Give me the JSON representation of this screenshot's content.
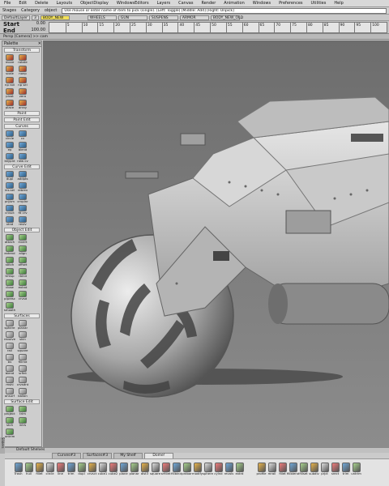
{
  "menubar": [
    "File",
    "Edit",
    "Delete",
    "Layouts",
    "ObjectDisplay",
    "WindowsEditors",
    "Layers",
    "Canvas",
    "Render",
    "Animation",
    "Windows",
    "Preferences",
    "Utilities",
    "Help"
  ],
  "toolrow": {
    "stages": "Stages",
    "category": "Category",
    "object": "object",
    "command_line": "Use mouse or enter name of item to pick (single). [Left: Toggle] [Middle: Add] [Right: Unpick]"
  },
  "layerrow": {
    "default": "DefaultLayer",
    "chips": [
      "BODY_NEW",
      "WHEELS",
      "GUN",
      "SUSPENS",
      "ARMOR",
      "BODY_NEW_OLD"
    ],
    "grid_num": "3"
  },
  "timeline": {
    "start_label": "Start",
    "start_value": "0.00",
    "end_label": "End",
    "end_value": "100.00",
    "current": "1.00",
    "ticks": [
      "5",
      "10",
      "15",
      "20",
      "25",
      "30",
      "35",
      "40",
      "45",
      "50",
      "55",
      "60",
      "65",
      "70",
      "75",
      "80",
      "85",
      "90",
      "95",
      "100"
    ]
  },
  "viewport_header": "Persp [Camera] >> cam",
  "palette": {
    "title": "Palette",
    "sections": [
      {
        "title": "Transform",
        "color": "c1",
        "tools": [
          "move",
          "rotate",
          "scale",
          "nonp",
          "np roll",
          "np sel",
          "pivot",
          "zero",
          "place",
          "array"
        ]
      },
      {
        "title": "Paint",
        "color": "c5",
        "tools": []
      },
      {
        "title": "Paint Edit",
        "color": "c5",
        "tools": []
      },
      {
        "title": "Curves",
        "color": "c2",
        "tools": [
          "circle",
          "cv",
          "ep",
          "blend",
          "keypnt",
          "new cv"
        ]
      },
      {
        "title": "Curve Edit",
        "color": "c2",
        "tools": [
          "dupl",
          "addpts",
          "ins.sel",
          "rebrev",
          "prj/sm",
          "crvplnr",
          "crvsct",
          "fit crv",
          "xtnd",
          "revlv"
        ]
      },
      {
        "title": "Object Edit",
        "color": "c3",
        "tools": [
          "attach",
          "invert",
          "extend",
          "align",
          "stitch",
          "offset",
          "trmsp",
          "rblnd",
          "close",
          "extnd",
          "plpresc",
          "crvsd",
          "smooth"
        ]
      },
      {
        "title": "Surfaces",
        "color": "c4",
        "tools": [
          "sphere",
          "planar",
          "revolve",
          "skin",
          "rail",
          "square",
          "bv",
          "fillrnd",
          "blend",
          "srfint",
          "mshl",
          "crvsdnt",
          "onsurf",
          "ballon"
        ]
      },
      {
        "title": "Surface Edit",
        "color": "c3",
        "tools": [
          "project",
          "trim",
          "stch",
          "intrs",
          "untrim"
        ]
      }
    ]
  },
  "shelf": {
    "title": "Default Shelves",
    "tabs": [
      "Curves#3",
      "Surfaces#3",
      "My Shelf",
      "Dome!"
    ],
    "active_tab": 3,
    "items": [
      "Trash",
      "hull",
      "fillet",
      "circle",
      "line",
      "trim",
      "dupl",
      "crvsct",
      "cube1",
      "cube2",
      "plane",
      "planar",
      "dist3",
      "square",
      "srfillet",
      "fillblnd",
      "pntbar",
      "modify",
      "sphere",
      "cylnd",
      "revolv",
      "extrd"
    ],
    "items_right": [
      "profile",
      "mrail",
      "fillet",
      "fillblend",
      "fillset",
      "subdiv",
      "prjct",
      "srect",
      "trim",
      "untrim"
    ]
  },
  "side_label": "Sliders",
  "colors": {
    "viewport_bg": "#7a7a7a",
    "panel": "#cdcdcd",
    "accent_yellow": "#f1e05a"
  },
  "icons": {
    "ball_wheel": "sphere-wheel",
    "vehicle": "armored-hovercraft-model"
  }
}
